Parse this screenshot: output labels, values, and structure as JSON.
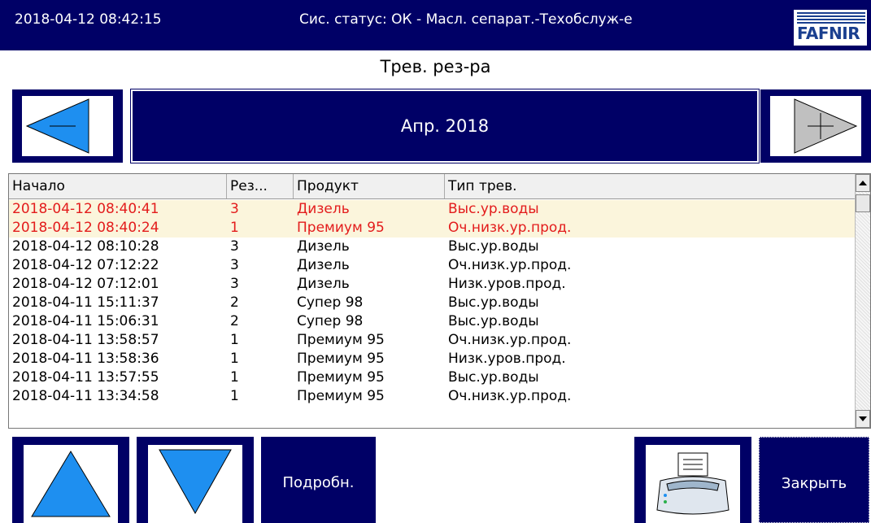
{
  "header": {
    "datetime": "2018-04-12 08:42:15",
    "status": "Сис. статус: ОК - Масл. сепарат.-Техобслуж-е",
    "logo_text": "FAFNIR"
  },
  "page": {
    "title": "Трев. рез-ра"
  },
  "period": {
    "label": "Апр. 2018"
  },
  "colors": {
    "navy": "#000066",
    "alarm_text": "#e31c1c",
    "alarm_row": "#fbf5dc",
    "arrow_blue": "#1e8ff0",
    "arrow_gray": "#c0c0c0"
  },
  "table": {
    "columns": [
      "Начало",
      "Рез...",
      "Продукт",
      "Тип трев."
    ],
    "rows": [
      {
        "start": "2018-04-12 08:40:41",
        "tank": "3",
        "product": "Дизель",
        "type": "Выс.ур.воды",
        "active": true
      },
      {
        "start": "2018-04-12 08:40:24",
        "tank": "1",
        "product": "Премиум 95",
        "type": "Оч.низк.ур.прод.",
        "active": true
      },
      {
        "start": "2018-04-12 08:10:28",
        "tank": "3",
        "product": "Дизель",
        "type": "Выс.ур.воды",
        "active": false
      },
      {
        "start": "2018-04-12 07:12:22",
        "tank": "3",
        "product": "Дизель",
        "type": "Оч.низк.ур.прод.",
        "active": false
      },
      {
        "start": "2018-04-12 07:12:01",
        "tank": "3",
        "product": "Дизель",
        "type": "Низк.уров.прод.",
        "active": false
      },
      {
        "start": "2018-04-11 15:11:37",
        "tank": "2",
        "product": "Супер 98",
        "type": "Выс.ур.воды",
        "active": false
      },
      {
        "start": "2018-04-11 15:06:31",
        "tank": "2",
        "product": "Супер 98",
        "type": "Выс.ур.воды",
        "active": false
      },
      {
        "start": "2018-04-11 13:58:57",
        "tank": "1",
        "product": "Премиум 95",
        "type": "Оч.низк.ур.прод.",
        "active": false
      },
      {
        "start": "2018-04-11 13:58:36",
        "tank": "1",
        "product": "Премиум 95",
        "type": "Низк.уров.прод.",
        "active": false
      },
      {
        "start": "2018-04-11 13:57:55",
        "tank": "1",
        "product": "Премиум 95",
        "type": "Выс.ур.воды",
        "active": false
      },
      {
        "start": "2018-04-11 13:34:58",
        "tank": "1",
        "product": "Премиум 95",
        "type": "Оч.низк.ур.прод.",
        "active": false
      }
    ]
  },
  "buttons": {
    "details": "Подробн.",
    "close": "Закрыть"
  }
}
